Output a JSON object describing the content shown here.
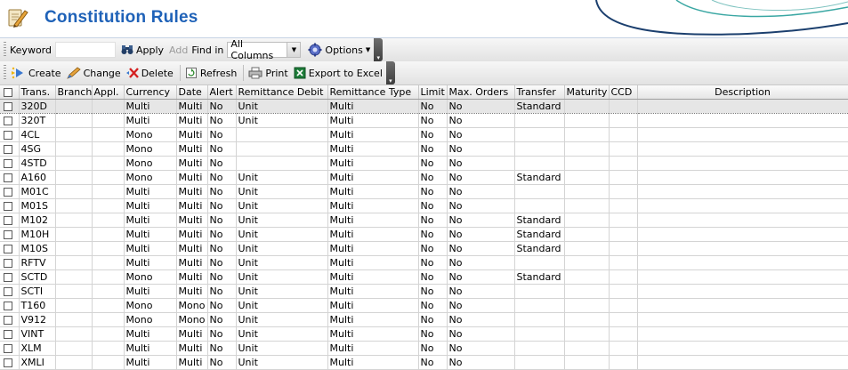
{
  "header": {
    "title": "Constitution Rules",
    "icon": "pencil-icon"
  },
  "toolbar1": {
    "keyword_label": "Keyword",
    "keyword_value": "",
    "apply_label": "Apply",
    "add_label": "Add",
    "find_in_label": "Find in",
    "find_in_value": "All Columns",
    "options_label": "Options"
  },
  "toolbar2": {
    "create_label": "Create",
    "change_label": "Change",
    "delete_label": "Delete",
    "refresh_label": "Refresh",
    "print_label": "Print",
    "export_label": "Export to Excel"
  },
  "table": {
    "columns": [
      "Trans.",
      "Branch",
      "Appl.",
      "Currency",
      "Date",
      "Alert",
      "Remittance Debit",
      "Remittance Type",
      "Limit",
      "Max. Orders",
      "Transfer",
      "Maturity",
      "CCD",
      "Description"
    ],
    "rows": [
      [
        "320D",
        "",
        "",
        "Multi",
        "Multi",
        "No",
        "Unit",
        "Multi",
        "No",
        "No",
        "Standard",
        "",
        "",
        ""
      ],
      [
        "320T",
        "",
        "",
        "Multi",
        "Multi",
        "No",
        "Unit",
        "Multi",
        "No",
        "No",
        "",
        "",
        "",
        ""
      ],
      [
        "4CL",
        "",
        "",
        "Mono",
        "Multi",
        "No",
        "",
        "Multi",
        "No",
        "No",
        "",
        "",
        "",
        ""
      ],
      [
        "4SG",
        "",
        "",
        "Mono",
        "Multi",
        "No",
        "",
        "Multi",
        "No",
        "No",
        "",
        "",
        "",
        ""
      ],
      [
        "4STD",
        "",
        "",
        "Mono",
        "Multi",
        "No",
        "",
        "Multi",
        "No",
        "No",
        "",
        "",
        "",
        ""
      ],
      [
        "A160",
        "",
        "",
        "Mono",
        "Multi",
        "No",
        "Unit",
        "Multi",
        "No",
        "No",
        "Standard",
        "",
        "",
        ""
      ],
      [
        "M01C",
        "",
        "",
        "Multi",
        "Multi",
        "No",
        "Unit",
        "Multi",
        "No",
        "No",
        "",
        "",
        "",
        ""
      ],
      [
        "M01S",
        "",
        "",
        "Multi",
        "Multi",
        "No",
        "Unit",
        "Multi",
        "No",
        "No",
        "",
        "",
        "",
        ""
      ],
      [
        "M102",
        "",
        "",
        "Multi",
        "Multi",
        "No",
        "Unit",
        "Multi",
        "No",
        "No",
        "Standard",
        "",
        "",
        ""
      ],
      [
        "M10H",
        "",
        "",
        "Multi",
        "Multi",
        "No",
        "Unit",
        "Multi",
        "No",
        "No",
        "Standard",
        "",
        "",
        ""
      ],
      [
        "M10S",
        "",
        "",
        "Multi",
        "Multi",
        "No",
        "Unit",
        "Multi",
        "No",
        "No",
        "Standard",
        "",
        "",
        ""
      ],
      [
        "RFTV",
        "",
        "",
        "Multi",
        "Multi",
        "No",
        "Unit",
        "Multi",
        "No",
        "No",
        "",
        "",
        "",
        ""
      ],
      [
        "SCTD",
        "",
        "",
        "Mono",
        "Multi",
        "No",
        "Unit",
        "Multi",
        "No",
        "No",
        "Standard",
        "",
        "",
        ""
      ],
      [
        "SCTI",
        "",
        "",
        "Multi",
        "Multi",
        "No",
        "Unit",
        "Multi",
        "No",
        "No",
        "",
        "",
        "",
        ""
      ],
      [
        "T160",
        "",
        "",
        "Mono",
        "Mono",
        "No",
        "Unit",
        "Multi",
        "No",
        "No",
        "",
        "",
        "",
        ""
      ],
      [
        "V912",
        "",
        "",
        "Mono",
        "Mono",
        "No",
        "Unit",
        "Multi",
        "No",
        "No",
        "",
        "",
        "",
        ""
      ],
      [
        "VINT",
        "",
        "",
        "Multi",
        "Multi",
        "No",
        "Unit",
        "Multi",
        "No",
        "No",
        "",
        "",
        "",
        ""
      ],
      [
        "XLM",
        "",
        "",
        "Multi",
        "Multi",
        "No",
        "Unit",
        "Multi",
        "No",
        "No",
        "",
        "",
        "",
        ""
      ],
      [
        "XMLI",
        "",
        "",
        "Multi",
        "Multi",
        "No",
        "Unit",
        "Multi",
        "No",
        "No",
        "",
        "",
        "",
        ""
      ]
    ],
    "selected_row": 0
  },
  "colors": {
    "title": "#1f62b8",
    "swoosh_dark": "#1b3f6e",
    "swoosh_teal": "#3aa7a3"
  }
}
